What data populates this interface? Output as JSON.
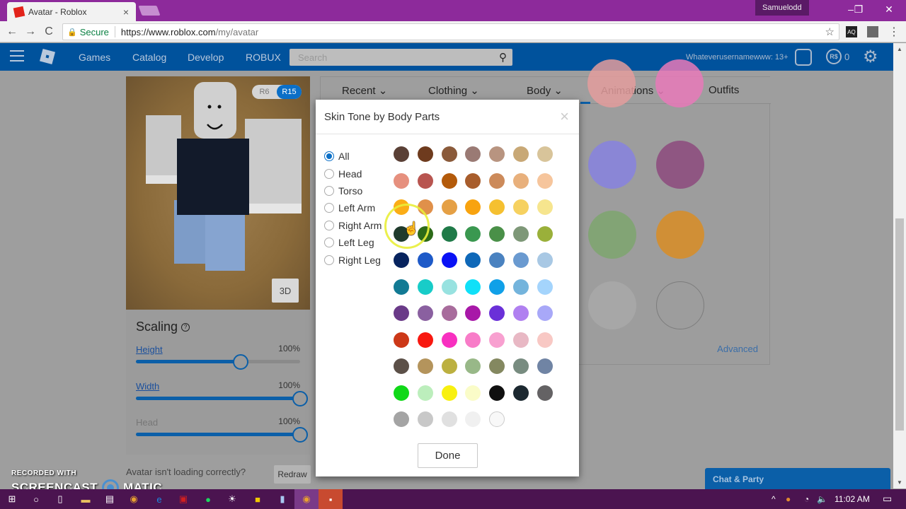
{
  "browser": {
    "tab_title": "Avatar - Roblox",
    "tab_close": "×",
    "profile_name": "Samuelodd",
    "minimize": "–",
    "restore": "❐",
    "close": "✕",
    "back": "←",
    "forward": "→",
    "reload": "C",
    "secure_label": "Secure",
    "url_host": "https://www.roblox.com",
    "url_path": "/my/avatar",
    "bookmark_star": "☆",
    "ext1": "AQ",
    "menu_dots": "⋮"
  },
  "header": {
    "nav": [
      "Games",
      "Catalog",
      "Develop",
      "ROBUX"
    ],
    "search_placeholder": "Search",
    "search_icon": "⚲",
    "username": "Whateverusernamewww: 13+",
    "robux_symbol": "R$",
    "robux_count": "0",
    "gear": "⚙"
  },
  "avatar": {
    "rig_r6": "R6",
    "rig_r15": "R15",
    "rig_selected": "R15",
    "view_3d": "3D"
  },
  "scaling": {
    "title": "Scaling",
    "help": "?",
    "sliders": [
      {
        "label": "Height",
        "value": "100%",
        "fill": 0.64,
        "enabled": true
      },
      {
        "label": "Width",
        "value": "100%",
        "fill": 1.0,
        "enabled": true
      },
      {
        "label": "Head",
        "value": "100%",
        "fill": 1.0,
        "enabled": false
      }
    ]
  },
  "redraw": {
    "prompt": "Avatar isn't loading correctly?",
    "button": "Redraw"
  },
  "editor": {
    "tabs": [
      "Recent ⌄",
      "Clothing ⌄",
      "Body ⌄",
      "Animations ⌄",
      "Outfits"
    ],
    "active_tab": "Body",
    "background_swatches": [
      "#e39c9c",
      "#e879b8",
      "#8783e0",
      "#8d4a7e",
      "#7ea66e",
      "#d98d24",
      "#a9a9a9",
      "#d0d0d0"
    ],
    "advanced_link": "Advanced"
  },
  "modal": {
    "title": "Skin Tone by Body Parts",
    "close": "×",
    "body_parts": [
      "All",
      "Head",
      "Torso",
      "Left Arm",
      "Right Arm",
      "Left Leg",
      "Right Leg"
    ],
    "selected_part": "All",
    "swatches": [
      [
        "#5a4036",
        "#6e3b1e",
        "#8a5a3a",
        "#9a7a74",
        "#b89480",
        "#c8a876",
        "#d8c49a"
      ],
      [
        "#e6907e",
        "#b85550",
        "#b35a0a",
        "#a85d2c",
        "#cc8a5a",
        "#e8b07c",
        "#f6c59c"
      ],
      [
        "#fbad16",
        "#e0904a",
        "#e5a045",
        "#f8a30f",
        "#f5c030",
        "#f6d160",
        "#f6e58e"
      ],
      [
        "#1f3a2c",
        "#2c6a18",
        "#1f7a48",
        "#3a9850",
        "#4a9048",
        "#7e9878",
        "#9ab03a"
      ],
      [
        "#07235e",
        "#1e5ac8",
        "#0a12f5",
        "#0f68b8",
        "#4a82c0",
        "#6a9ad0",
        "#a8c8e4"
      ],
      [
        "#127a94",
        "#18ccc8",
        "#98e2e0",
        "#10e0f8",
        "#10a0e8",
        "#74b4dc",
        "#a4d4fc"
      ],
      [
        "#6a3a88",
        "#8a60a0",
        "#a86c9c",
        "#a818a8",
        "#6a30d8",
        "#b080f0",
        "#a8a8f8"
      ],
      [
        "#cc3818",
        "#f81810",
        "#f830c0",
        "#f87cc8",
        "#f8a0d0",
        "#e8b8c4",
        "#f8c8c4"
      ],
      [
        "#5c5048",
        "#b4945c",
        "#bcb040",
        "#98b888",
        "#848860",
        "#788c80",
        "#7084a4"
      ],
      [
        "#10d818",
        "#bceebc",
        "#f8f010",
        "#fafcc8",
        "#101010",
        "#1c2830",
        "#646264"
      ],
      [
        "#a4a4a4",
        "#c8c8c8",
        "#e0e0e0",
        "#f0f0f0",
        "#f8f8f8"
      ]
    ],
    "done": "Done"
  },
  "chat": {
    "label": "Chat & Party"
  },
  "watermark": {
    "line1": "RECORDED WITH",
    "line2a": "SCREENCAST",
    "line2b": "MATIC"
  },
  "taskbar": {
    "time": "11:02 AM",
    "tray_chevron": "^",
    "wifi": "◔",
    "volume": "🔈"
  },
  "scrollbar": {
    "up": "▲",
    "down": "▼",
    "position": 0.4
  }
}
